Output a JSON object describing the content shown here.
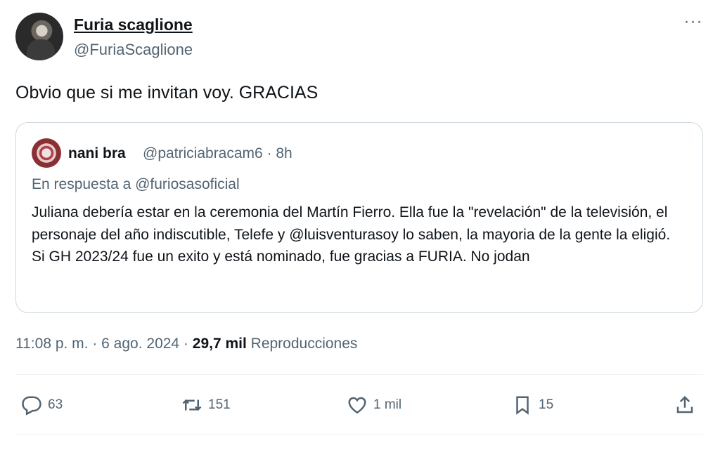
{
  "author": {
    "name": "Furia scaglione",
    "handle": "@FuriaScaglione"
  },
  "more_icon_glyph": "···",
  "tweet": {
    "text": "Obvio que si me invitan voy. GRACIAS"
  },
  "quote": {
    "name": "nani bra",
    "handle_time": "@patriciabracam6 · 8h",
    "reply_to": "En respuesta a @furiosasoficial",
    "body": "Juliana debería estar en la ceremonia del Martín Fierro. Ella fue la \"revelación\" de la televisión, el personaje del año indiscutible, Telefe y @luisventurasoy  lo saben, la mayoria de la gente la eligió. Si GH 2023/24 fue un exito y está nominado, fue gracias a FURIA. No jodan"
  },
  "meta": {
    "timestamp": "11:08 p. m. · 6 ago. 2024 · ",
    "views_count": "29,7 mil",
    "views_label": " Reproducciones"
  },
  "actions": {
    "replies": "63",
    "retweets": "151",
    "likes": "1 mil",
    "bookmarks": "15"
  },
  "icons": {
    "reply": "reply-icon",
    "retweet": "retweet-icon",
    "like": "heart-icon",
    "bookmark": "bookmark-icon",
    "share": "share-icon",
    "more": "more-icon"
  },
  "colors": {
    "text": "#0f1419",
    "secondary": "#536471",
    "border": "#cfd9de"
  }
}
